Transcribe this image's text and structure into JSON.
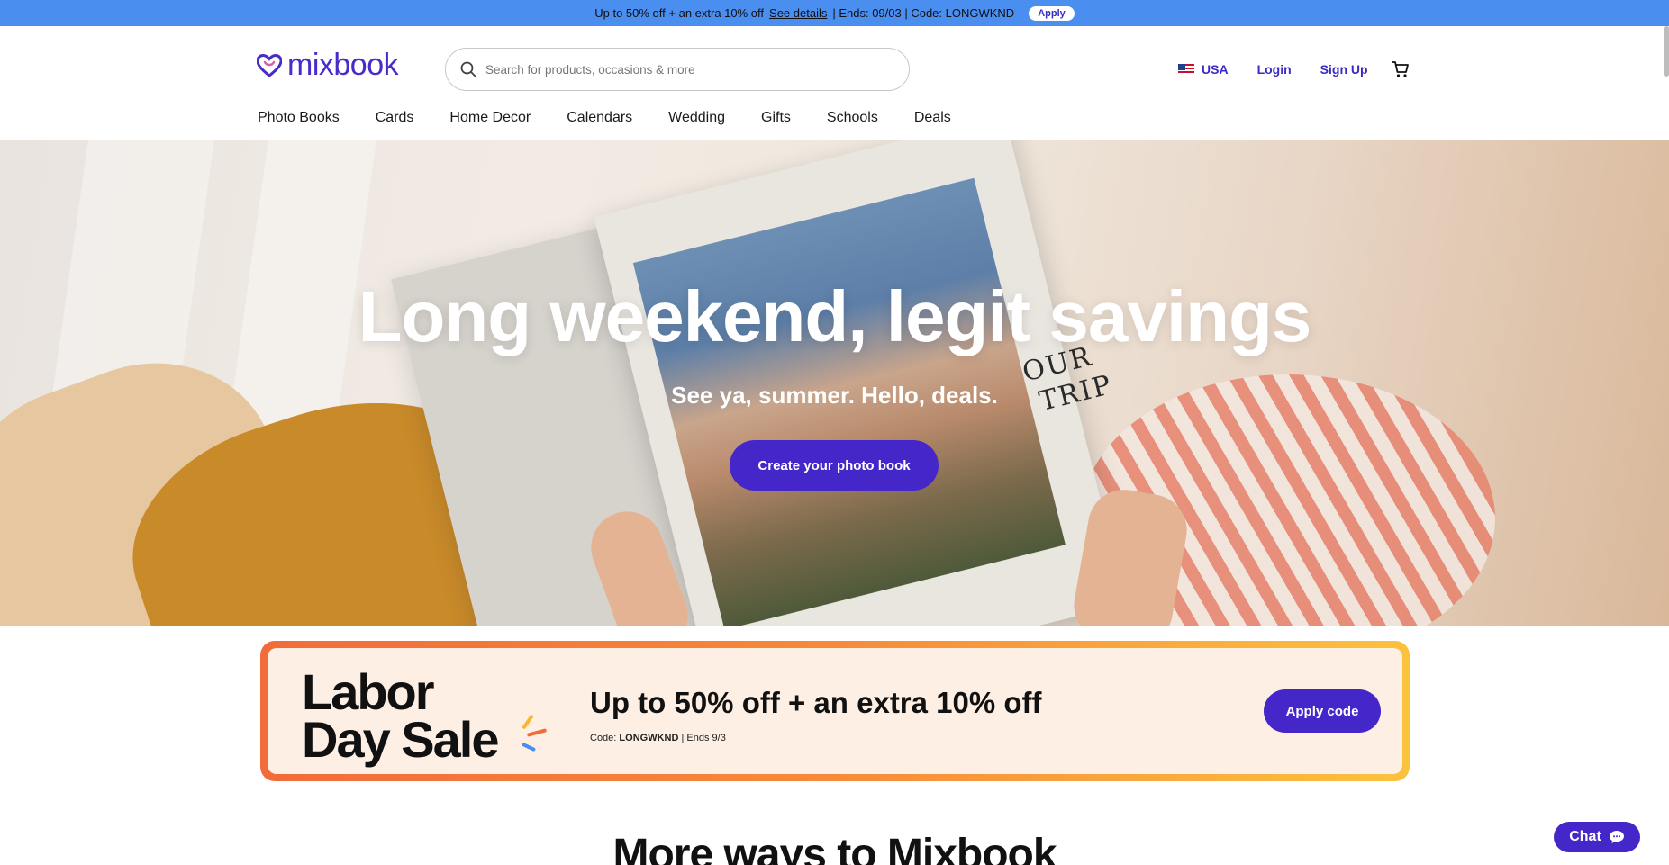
{
  "promo_bar": {
    "text": "Up to 50% off + an extra 10% off",
    "details_link": "See details",
    "ends": "| Ends: 09/03 | Code: LONGWKND",
    "apply_label": "Apply"
  },
  "header": {
    "logo_text": "mixbook",
    "search_placeholder": "Search for products, occasions & more",
    "region_label": "USA",
    "login_label": "Login",
    "signup_label": "Sign Up",
    "cart_icon": "cart-icon"
  },
  "nav": {
    "items": [
      {
        "label": "Photo Books"
      },
      {
        "label": "Cards"
      },
      {
        "label": "Home Decor"
      },
      {
        "label": "Calendars"
      },
      {
        "label": "Wedding"
      },
      {
        "label": "Gifts"
      },
      {
        "label": "Schools"
      },
      {
        "label": "Deals"
      }
    ]
  },
  "hero": {
    "title": "Long weekend, legit savings",
    "subtitle": "See ya, summer. Hello, deals.",
    "cta_label": "Create your photo book",
    "book_title_line1": "OUR",
    "book_title_line2": "TRIP"
  },
  "sale_banner": {
    "title_line1": "Labor",
    "title_line2": "Day Sale",
    "headline": "Up to 50% off + an extra 10% off",
    "code_prefix": "Code: ",
    "code": "LONGWKND",
    "ends": " | Ends 9/3",
    "cta_label": "Apply code"
  },
  "section": {
    "more_title": "More ways to Mixbook"
  },
  "chat": {
    "label": "Chat"
  },
  "colors": {
    "brand_purple": "#4527c9",
    "promo_blue": "#4a8ef0",
    "banner_gradient_start": "#f26b3a",
    "banner_gradient_end": "#fbc23e"
  }
}
